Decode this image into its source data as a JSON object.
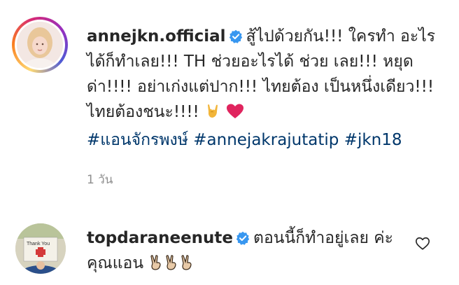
{
  "post": {
    "username": "annejkn.official",
    "caption_part1": "สู้ไปด้วยกัน!!! ใครทำ อะไรได้ก็ทำเลย!!! TH ช่วยอะไรได้ ช่วย เลย!!! หยุดด่า!!!! อย่าเก่งแต่ปาก!!! ไทยต้อง เป็นหนึ่งเดียว!!! ไทยต้องชนะ!!!!",
    "hashtags": [
      "#แอนจักรพงษ์",
      "#annejakrajutatip",
      "#jkn18"
    ],
    "time": "1 วัน",
    "emojis": [
      "rock-hand-emoji",
      "red-heart-emoji"
    ]
  },
  "comment": {
    "username": "topdaraneenute",
    "text": "ตอนนี้ก็ทำอยู่เลย ค่ะคุณแอน",
    "emojis": [
      "victory-hand-emoji",
      "victory-hand-emoji",
      "victory-hand-emoji"
    ],
    "avatar_sign_text": "Thank You"
  },
  "colors": {
    "verified": "#3897f0",
    "hashtag": "#00376b",
    "meta": "#8e8e8e",
    "heart_emoji": "#e0245e"
  }
}
